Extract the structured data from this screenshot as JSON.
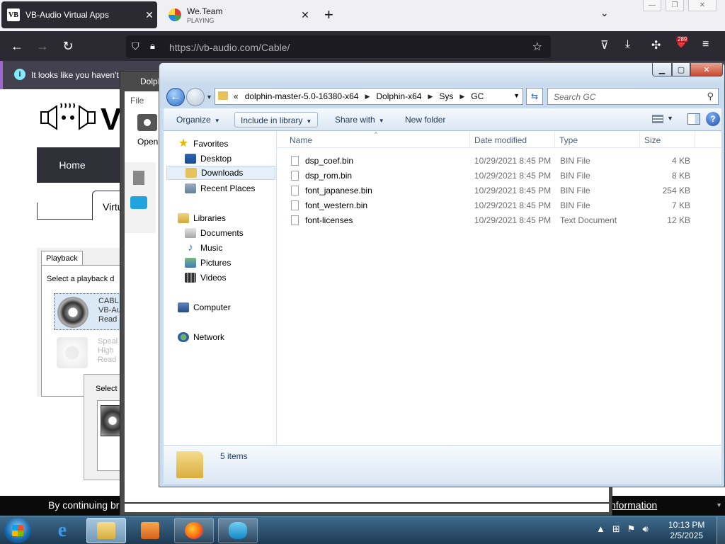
{
  "browser": {
    "tabs": [
      {
        "title": "VB-Audio Virtual Apps",
        "favicon": "VB"
      },
      {
        "title": "We.Team",
        "subtitle": "PLAYING"
      }
    ],
    "url": "https://vb-audio.com/Cable/",
    "notification_badge": "289",
    "notice": "It looks like you haven't"
  },
  "site": {
    "nav_home": "Home",
    "tab_label": "Virtu",
    "logo_letter": "V",
    "playback": {
      "tab": "Playback",
      "select_text": "Select a playback d",
      "device1": {
        "name": "CABL",
        "line2": "VB-Au",
        "line3": "Read"
      },
      "device2": {
        "name": "Speal",
        "line2": "High",
        "line3": "Read"
      }
    },
    "select_dialog": "Select",
    "cookie_text": "By continuing br",
    "cookie_link": "nformation"
  },
  "dolphin": {
    "title": "Dolph",
    "menu": "File",
    "open": "Open"
  },
  "explorer": {
    "breadcrumb": [
      "dolphin-master-5.0-16380-x64",
      "Dolphin-x64",
      "Sys",
      "GC"
    ],
    "breadcrumb_prefix": "«",
    "search_placeholder": "Search GC",
    "toolbar": {
      "organize": "Organize",
      "include": "Include in library",
      "share": "Share with",
      "new_folder": "New folder"
    },
    "nav": {
      "favorites": "Favorites",
      "desktop": "Desktop",
      "downloads": "Downloads",
      "recent": "Recent Places",
      "libraries": "Libraries",
      "documents": "Documents",
      "music": "Music",
      "pictures": "Pictures",
      "videos": "Videos",
      "computer": "Computer",
      "network": "Network"
    },
    "columns": {
      "name": "Name",
      "date": "Date modified",
      "type": "Type",
      "size": "Size"
    },
    "files": [
      {
        "name": "dsp_coef.bin",
        "date": "10/29/2021 8:45 PM",
        "type": "BIN File",
        "size": "4 KB"
      },
      {
        "name": "dsp_rom.bin",
        "date": "10/29/2021 8:45 PM",
        "type": "BIN File",
        "size": "8 KB"
      },
      {
        "name": "font_japanese.bin",
        "date": "10/29/2021 8:45 PM",
        "type": "BIN File",
        "size": "254 KB"
      },
      {
        "name": "font_western.bin",
        "date": "10/29/2021 8:45 PM",
        "type": "BIN File",
        "size": "7 KB"
      },
      {
        "name": "font-licenses",
        "date": "10/29/2021 8:45 PM",
        "type": "Text Document",
        "size": "12 KB"
      }
    ],
    "item_count": "5 items"
  },
  "taskbar": {
    "time": "10:13 PM",
    "date": "2/5/2025"
  }
}
